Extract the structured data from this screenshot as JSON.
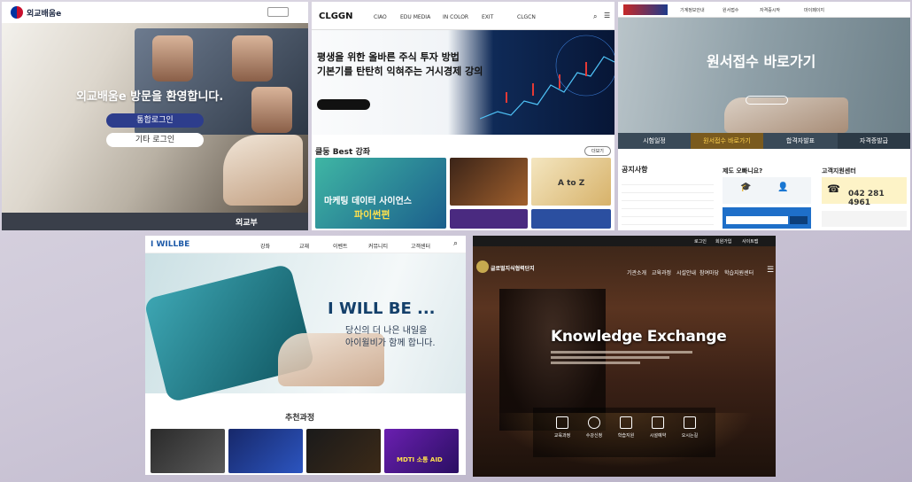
{
  "panel1": {
    "logo_text": "외교배움e",
    "hero_text": "외교배움e 방문을 환영합니다.",
    "member_login": "통합로그인",
    "other_login": "기타 로그인",
    "footer_brand": "외교부"
  },
  "panel2": {
    "logo": "CLGGN",
    "nav": [
      "CIAO",
      "EDU MEDIA",
      "IN COLOR",
      "EXIT",
      "CLGCN"
    ],
    "hero_line1": "평생을 위한 올바른 주식 투자 방법",
    "hero_line2": "기본기를 탄탄히 익혀주는 거시경제 강의",
    "section_title": "클둥 Best 강좌",
    "more": "더보기",
    "card1_title1": "마케팅 데이터 사이언스",
    "card1_title2": "파이썬편",
    "card3_title": "A to Z"
  },
  "panel3": {
    "nav": [
      "기계정보안내",
      "원서접수",
      "자격증시작",
      "마이페이지"
    ],
    "hero_title": "원서접수 바로가기",
    "tabs": [
      "시험일정",
      "원서접수 바로가기",
      "합격자발표",
      "자격증발급"
    ],
    "notice_title": "공지사항",
    "qa_title": "제도 오빠니요?",
    "customer_title": "고객지원센터",
    "phone": "042 281 4961"
  },
  "panel4": {
    "logo": "I WILLBE",
    "nav": [
      "강좌",
      "교재",
      "이벤트",
      "커뮤니티",
      "고객센터"
    ],
    "hero_title": "I WILL BE ...",
    "hero_sub1": "당신의 더 나은 내일을",
    "hero_sub2": "아이윌비가 함께 합니다.",
    "section_title": "추천과정",
    "course3_text": "MDTI 소통 AID"
  },
  "panel5": {
    "top_links": [
      "로그인",
      "회원가입",
      "사이트맵"
    ],
    "logo_text": "글로벌지식협력단지",
    "nav": [
      "기관소개",
      "교육과정",
      "시설안내",
      "참여마당",
      "학습지원센터"
    ],
    "hero_title": "Knowledge Exchange",
    "icons": [
      "교육과정",
      "수강신청",
      "학습지원",
      "시설예약",
      "오시는길"
    ]
  },
  "colors": {
    "navy": "#2d3d8c",
    "blue": "#1e63b5",
    "teal": "#2ba0a8"
  }
}
